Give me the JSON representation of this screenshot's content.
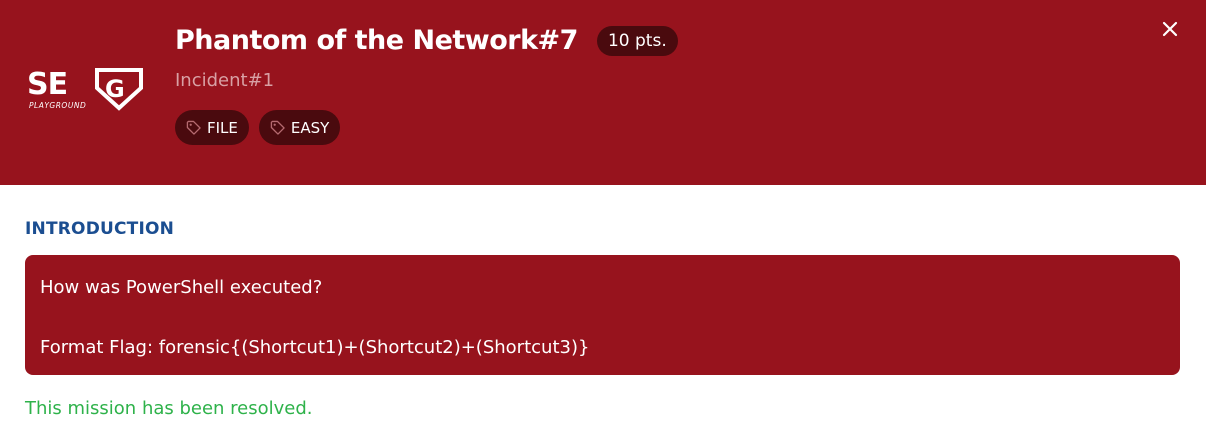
{
  "header": {
    "logo_text": "SEG PLAYGROUND",
    "title": "Phantom of the Network#7",
    "points": "10 pts.",
    "subtitle": "Incident#1",
    "tags": [
      {
        "label": "FILE",
        "icon": "tag-icon"
      },
      {
        "label": "EASY",
        "icon": "tag-icon"
      }
    ],
    "close_icon": "close-icon"
  },
  "intro": {
    "heading": "INTRODUCTION",
    "line1": "How was PowerShell executed?",
    "line2": "Format Flag: forensic{(Shortcut1)+(Shortcut2)+(Shortcut3)}"
  },
  "status": {
    "message": "This mission has been resolved."
  },
  "colors": {
    "brand": "#97131d",
    "badge": "#4a0a0e",
    "heading": "#1b4e91",
    "success": "#2eb24a"
  }
}
